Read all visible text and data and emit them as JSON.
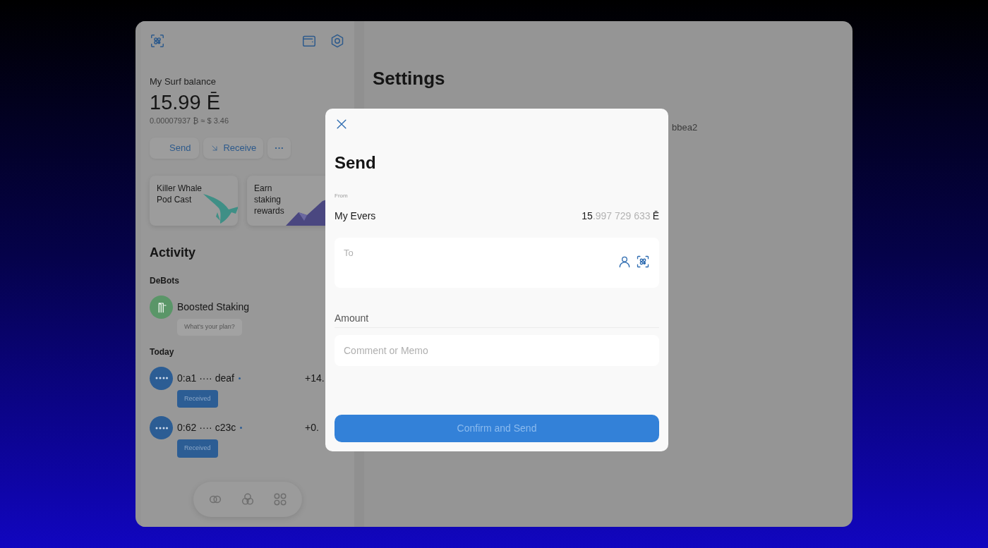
{
  "balance": {
    "label": "My Surf balance",
    "amount": "15.99 Ē",
    "fiat": "0.00007937 ₿ ≈ $ 3.46"
  },
  "actions": [
    {
      "kind": "send",
      "label": "Send"
    },
    {
      "kind": "receive",
      "label": "Receive"
    },
    {
      "kind": "more",
      "label": "···"
    }
  ],
  "promos": [
    {
      "kind": "whale",
      "title": "Killer Whale Pod Cast"
    },
    {
      "kind": "mountain",
      "title": "Earn staking rewards"
    }
  ],
  "activity": {
    "title": "Activity",
    "sections": [
      {
        "title": "DeBots",
        "items": [
          {
            "kind": "debot",
            "name": "Boosted Staking",
            "note": "What's your plan?"
          }
        ]
      },
      {
        "title": "Today",
        "items": [
          {
            "kind": "transfer",
            "address": "0:a1 ···· deaf",
            "amount": "+14.",
            "tag": "Received"
          },
          {
            "kind": "transfer",
            "address": "0:62 ···· c23c",
            "amount": "+0.",
            "tag": "Received"
          }
        ]
      }
    ]
  },
  "settings": {
    "title": "Settings",
    "address_tail": "bbea2"
  },
  "modal": {
    "title": "Send",
    "from_label": "From",
    "from_name": "My Evers",
    "balance_whole": "15",
    "balance_fraction": ".997 729 633",
    "currency": "Ē",
    "to": {
      "placeholder": "To"
    },
    "amount": {
      "placeholder": "Amount"
    },
    "memo": {
      "placeholder": "Comment or Memo"
    },
    "confirm": {
      "label": "Confirm and Send",
      "disabled": true
    }
  }
}
